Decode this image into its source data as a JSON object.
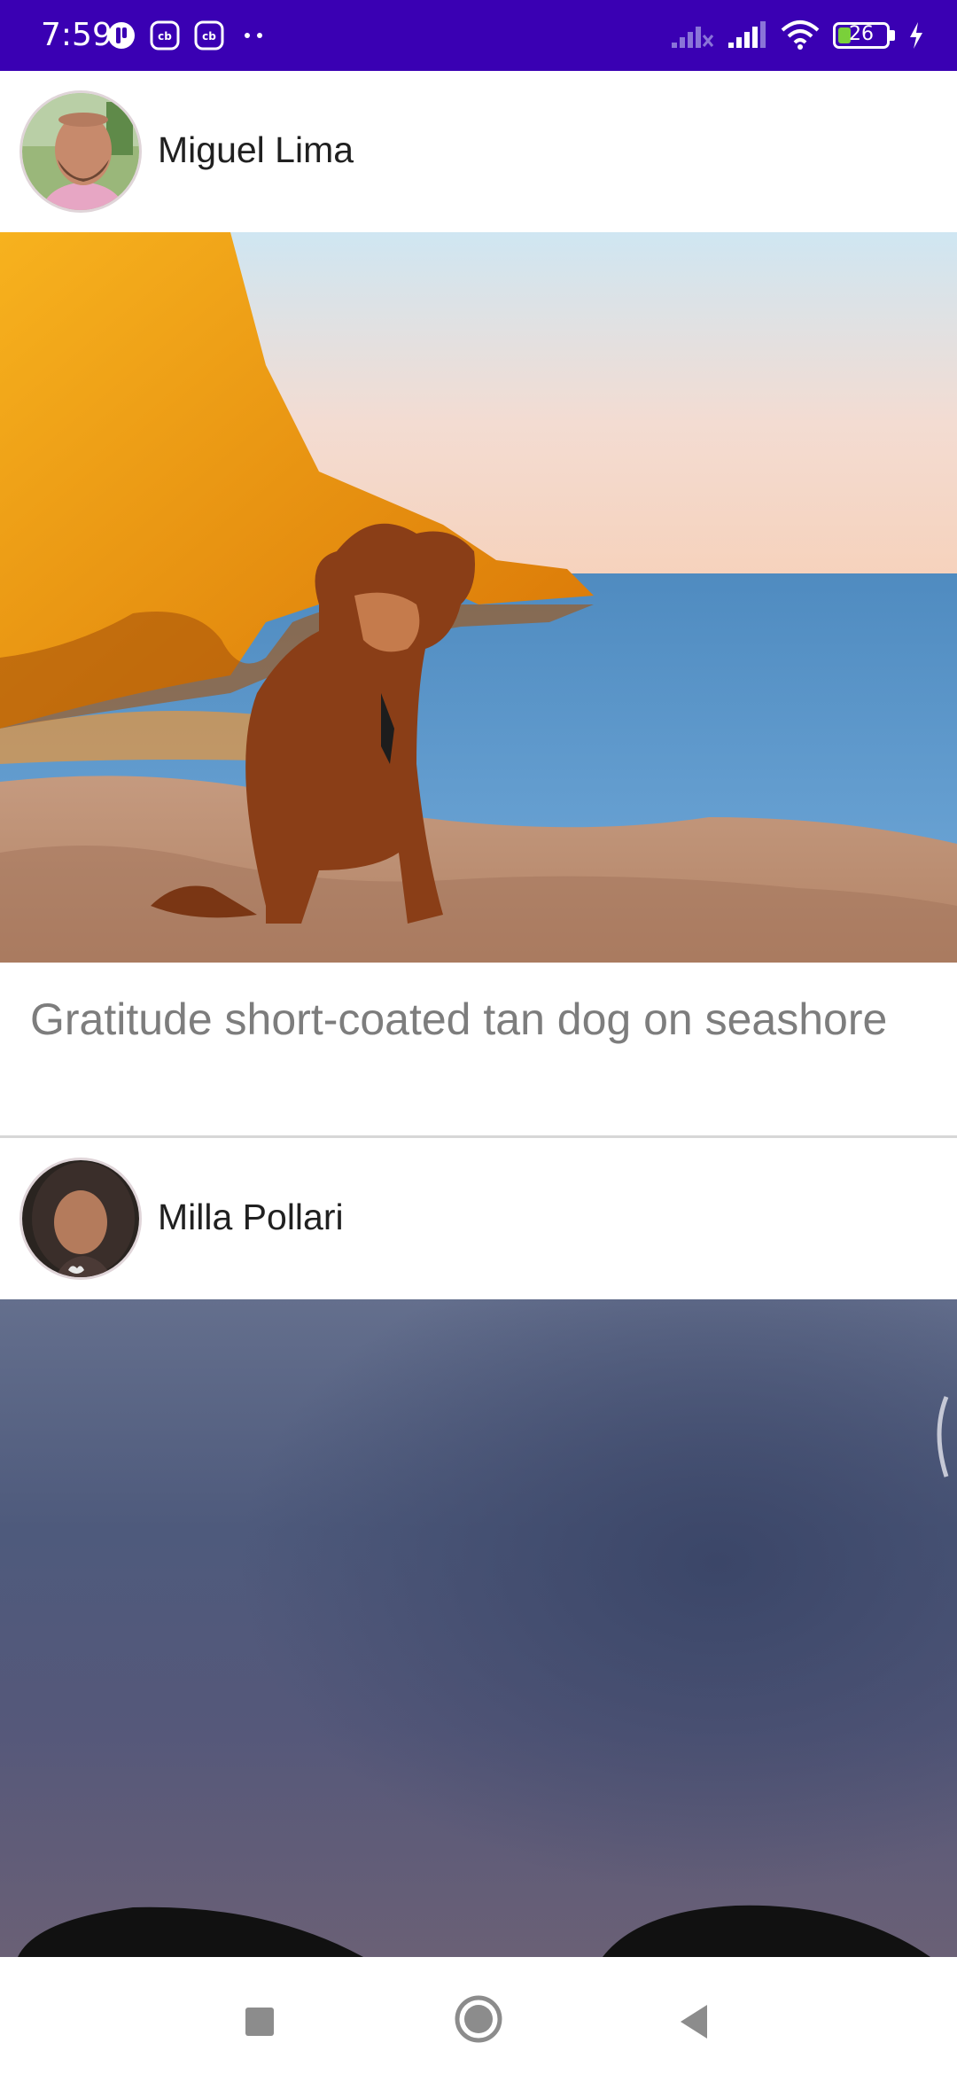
{
  "status_bar": {
    "time": "7:59",
    "battery_level": "26",
    "battery_fraction": 0.26,
    "icons": [
      "notification-app-icon",
      "cb-icon",
      "cb-icon",
      "more-dots-icon",
      "signal-no-service-icon",
      "signal-bars-icon",
      "wifi-icon",
      "battery-icon",
      "charging-bolt-icon"
    ]
  },
  "feed": {
    "posts": [
      {
        "author": "Miguel Lima",
        "caption": "Gratitude short-coated tan dog on seashore",
        "image_description_icon": "dog-on-beach-photo"
      },
      {
        "author": "Milla Pollari",
        "image_description_icon": "dog-ears-dusk-photo"
      }
    ]
  },
  "nav_bar": {
    "buttons": [
      "recents-button",
      "home-button",
      "back-button"
    ]
  },
  "colors": {
    "status_bar_bg": "#3a00b3",
    "caption_text": "#7d7d7d",
    "name_text": "#202020"
  }
}
